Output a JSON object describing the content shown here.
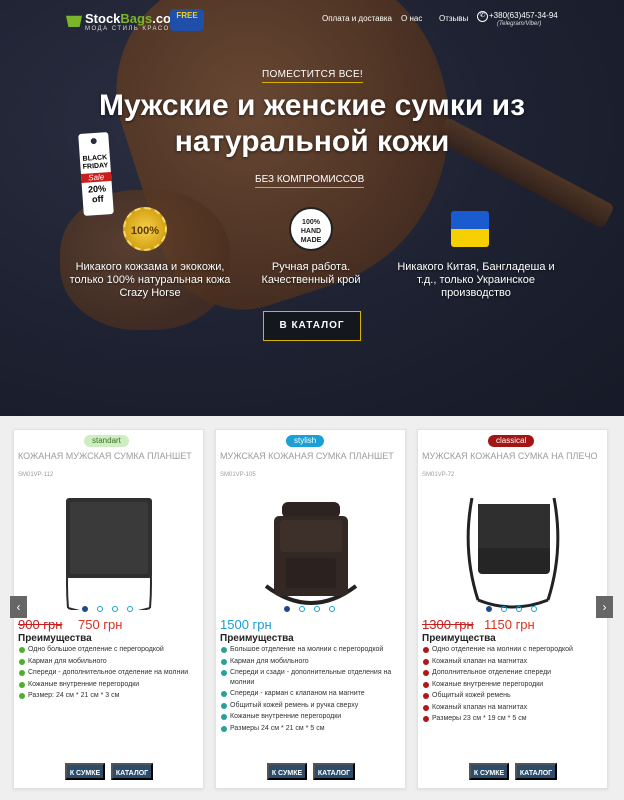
{
  "header": {
    "logo_main": "Stock",
    "logo_accent": "Bags",
    "logo_domain": ".com.ua",
    "logo_tagline": "МОДА  СТИЛЬ  КРАСОТА",
    "logo_badge": "FREE",
    "nav": [
      "Оплата и доставка",
      "О нас",
      "Отзывы"
    ],
    "phone": "+380(63)457-34-94",
    "phone_note": "(Telegram/Viber)"
  },
  "hero": {
    "pre_title": "ПОМЕСТИТСЯ ВСЕ!",
    "title": "Мужские и женские сумки из натуральной кожи",
    "subtitle": "БЕЗ КОМПРОМИССОВ",
    "black_friday": {
      "line1": "BLACK FRIDAY",
      "line2": "Sale",
      "line3": "20% off"
    },
    "features": [
      {
        "icon": "gold-seal-icon",
        "seal_text": "100%",
        "text": "Никакого кожзама и экокожи, только 100% натуральная кожа Crazy Horse"
      },
      {
        "icon": "handmade-icon",
        "seal_text": "100% HAND MADE",
        "text": "Ручная работа. Качественный крой"
      },
      {
        "icon": "ukraine-flag-icon",
        "text": "Никакого Китая, Бангладеша и т.д., только Украинское производство"
      }
    ],
    "catalog_button": "В КАТАЛОГ"
  },
  "products": [
    {
      "badge": "standart",
      "badge_color": "#cdeec0",
      "badge_text_color": "#3c6e2c",
      "title": "КОЖАНАЯ МУЖСКАЯ СУМКА ПЛАНШЕТ",
      "sku": "SM01VP-112",
      "old_price": "900 грн",
      "price": "750 грн",
      "bullet_color": "#4fae2e",
      "advantages_title": "Преимущества",
      "advantages": [
        "Одно большое отделение с перегородкой",
        "Карман для мобильного",
        "Спереди - дополнительное отделение на молнии",
        "Кожаные внутренние перегородки",
        "Размер: 24 см * 21 см * 3 см"
      ],
      "buy": "К СУМКЕ",
      "catalog": "КАТАЛОГ"
    },
    {
      "badge": "stylish",
      "badge_color": "#1aa0d5",
      "badge_text_color": "#ffffff",
      "title": "МУЖСКАЯ КОЖАНАЯ СУМКА ПЛАНШЕТ",
      "sku": "SM01VP-105",
      "old_price": "",
      "price": "1500 грн",
      "bullet_color": "#2aa198",
      "advantages_title": "Преимущества",
      "advantages": [
        "Большое отделение на молнии с перегородкой",
        "Карман для мобильного",
        "Спереди и сзади - дополнительные отделения на молнии",
        "Спереди - карман с клапаном на магните",
        "Общитый кожей ремень и ручка сверху",
        "Кожаные внутренние перегородки",
        "Размеры 24 см * 21 см * 5 см"
      ],
      "buy": "К СУМКЕ",
      "catalog": "КАТАЛОГ"
    },
    {
      "badge": "classical",
      "badge_color": "#a31515",
      "badge_text_color": "#ffffff",
      "title": "МУЖСКАЯ КОЖАНАЯ СУМКА НА ПЛЕЧО",
      "sku": "SM01VP-72",
      "old_price": "1300 грн",
      "price": "1150 грн",
      "bullet_color": "#b01818",
      "advantages_title": "Преимущества",
      "advantages": [
        "Одно отделение на молнии с перегородкой",
        "Кожаный клапан на магнитах",
        "Дополнительное отделение спереди",
        "Кожаные внутренние перегородки",
        "Общитый кожей ремень",
        "Кожаный клапан на магнитах",
        "Размеры 23 см * 19 см * 5 см"
      ],
      "buy": "К СУМКЕ",
      "catalog": "КАТАЛОГ"
    }
  ],
  "carousel": {
    "prev_icon": "‹",
    "next_icon": "›"
  }
}
